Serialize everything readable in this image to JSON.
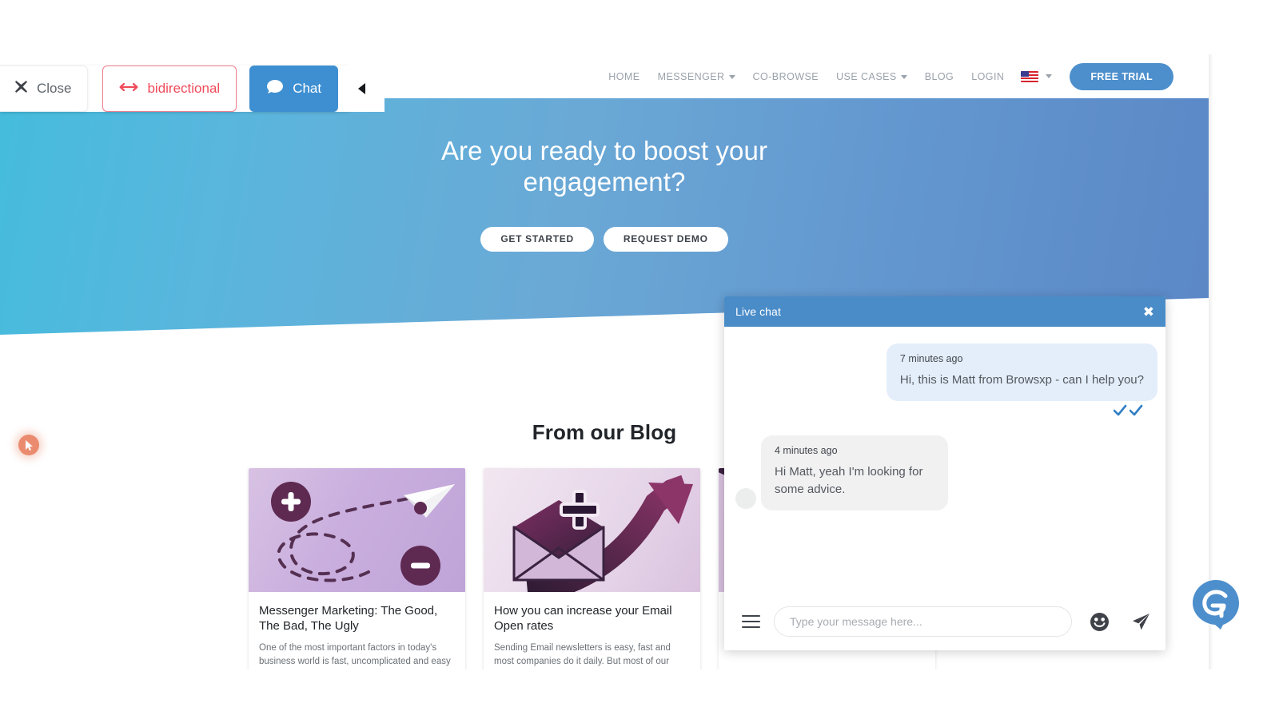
{
  "toolbar": {
    "close_label": "Close",
    "close_icon": "close-x-icon",
    "bidirectional_label": "bidirectional",
    "bidirectional_icon": "left-right-arrow-icon",
    "chat_label": "Chat",
    "chat_icon": "speech-bubble-icon",
    "collapse_icon": "caret-left-icon",
    "accent_red": "#ef4a5a",
    "accent_blue": "#3d8fd1"
  },
  "site_nav": {
    "links": [
      {
        "label": "HOME",
        "has_dropdown": false
      },
      {
        "label": "MESSENGER",
        "has_dropdown": true
      },
      {
        "label": "CO-BROWSE",
        "has_dropdown": false
      },
      {
        "label": "USE CASES",
        "has_dropdown": true
      },
      {
        "label": "BLOG",
        "has_dropdown": false
      },
      {
        "label": "LOGIN",
        "has_dropdown": false
      }
    ],
    "language_flag": "us-flag-icon",
    "language_caret": "caret-down-icon",
    "cta_label": "FREE TRIAL",
    "cta_color": "#4d8fcc"
  },
  "hero": {
    "title": "Are you ready to boost your engagement?",
    "buttons": [
      {
        "label": "GET STARTED"
      },
      {
        "label": "REQUEST DEMO"
      }
    ],
    "gradient_from": "#45bcdd",
    "gradient_to": "#5b87c6"
  },
  "blog": {
    "heading": "From our Blog",
    "cards": [
      {
        "art": "paper-plane-illustration",
        "title": "Messenger Marketing: The Good, The Bad, The Ugly",
        "excerpt": "One of the most important factors in today's business world is fast, uncomplicated and easy communication. This is especially true for communication between businesses and their"
      },
      {
        "art": "email-open-rate-illustration",
        "title": "How you can increase your Email Open rates",
        "excerpt": "Sending Email newsletters is easy, fast and most companies do it daily. But most of our customers are rapidly losing interest in these kinds of newsletters. So, how can we as a company send"
      },
      {
        "art": "third-card-illustration",
        "title": "",
        "excerpt": ""
      }
    ]
  },
  "chat_widget": {
    "header_title": "Live chat",
    "close_icon": "close-x-icon",
    "header_color": "#4a8cc8",
    "messages": [
      {
        "side": "agent",
        "time": "7 minutes ago",
        "text": "Hi, this is Matt from Browsxp - can I help you?",
        "read_receipt": "double-check-icon"
      },
      {
        "side": "user",
        "time": "4 minutes ago",
        "text": "Hi Matt, yeah I'm looking for some advice."
      }
    ],
    "menu_icon": "hamburger-menu-icon",
    "input_placeholder": "Type your message here...",
    "input_value": "",
    "emoji_icon": "smiley-face-icon",
    "send_icon": "paper-plane-send-icon"
  },
  "launcher": {
    "icon": "browsxp-chat-launcher-icon",
    "color": "#4d8fcc"
  },
  "cursor": {
    "icon": "mouse-pointer-icon",
    "color": "#ea8b6f"
  }
}
